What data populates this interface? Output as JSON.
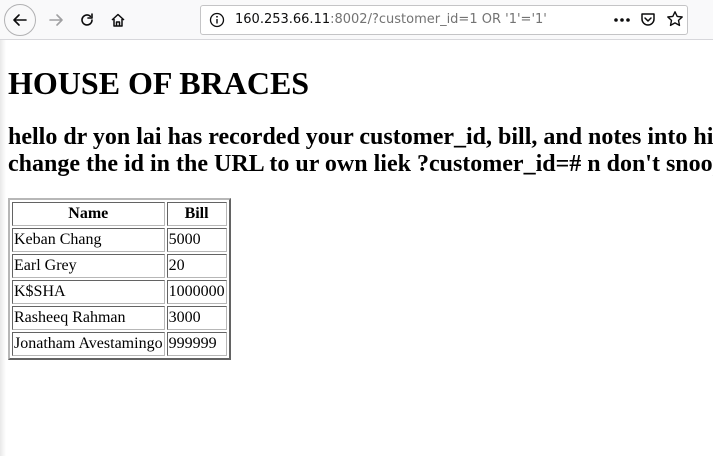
{
  "browser": {
    "url_host": "160.253.66.11",
    "url_rest": ":8002/?customer_id=1 OR '1'='1'",
    "icons": {
      "back": "back-arrow-icon",
      "forward": "forward-arrow-icon",
      "reload": "reload-icon",
      "home": "home-icon",
      "info": "info-icon",
      "page_actions": "ellipsis-icon",
      "pocket": "pocket-icon",
      "bookmark": "star-icon"
    }
  },
  "page": {
    "title": "HOUSE OF BRACES",
    "message_line1": "hello dr yon lai has recorded your customer_id, bill, and notes into his",
    "message_line2": "change the id in the URL to ur own liek ?customer_id=# n don't snoop"
  },
  "table": {
    "headers": [
      "Name",
      "Bill"
    ],
    "rows": [
      [
        "Keban Chang",
        "5000"
      ],
      [
        "Earl Grey",
        "20"
      ],
      [
        "K$SHA",
        "1000000"
      ],
      [
        "Rasheeq Rahman",
        "3000"
      ],
      [
        "Jonatham Avestamingo",
        "999999"
      ]
    ]
  }
}
